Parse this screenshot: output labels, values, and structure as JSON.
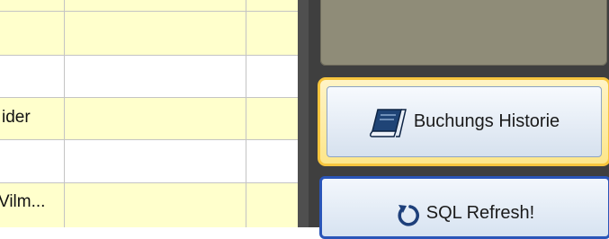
{
  "grid": {
    "rows": [
      {
        "text": "",
        "color": "#ffffcc"
      },
      {
        "text": "",
        "color": "#ffffff"
      },
      {
        "text": "ider",
        "color": "#ffffcc"
      },
      {
        "text": "",
        "color": "#ffffff"
      },
      {
        "text": "Vilm...",
        "color": "#ffffcc"
      }
    ]
  },
  "buttons": {
    "history": {
      "label": "Buchungs Historie",
      "icon": "book-icon"
    },
    "refresh": {
      "label": "SQL Refresh!",
      "icon": "refresh-icon"
    }
  },
  "colors": {
    "row_highlight": "#ffffcc",
    "panel_bg": "#3f3f3f",
    "top_box": "#8f8c78",
    "history_border": "#f7c53e",
    "refresh_border": "#2a55b8"
  }
}
